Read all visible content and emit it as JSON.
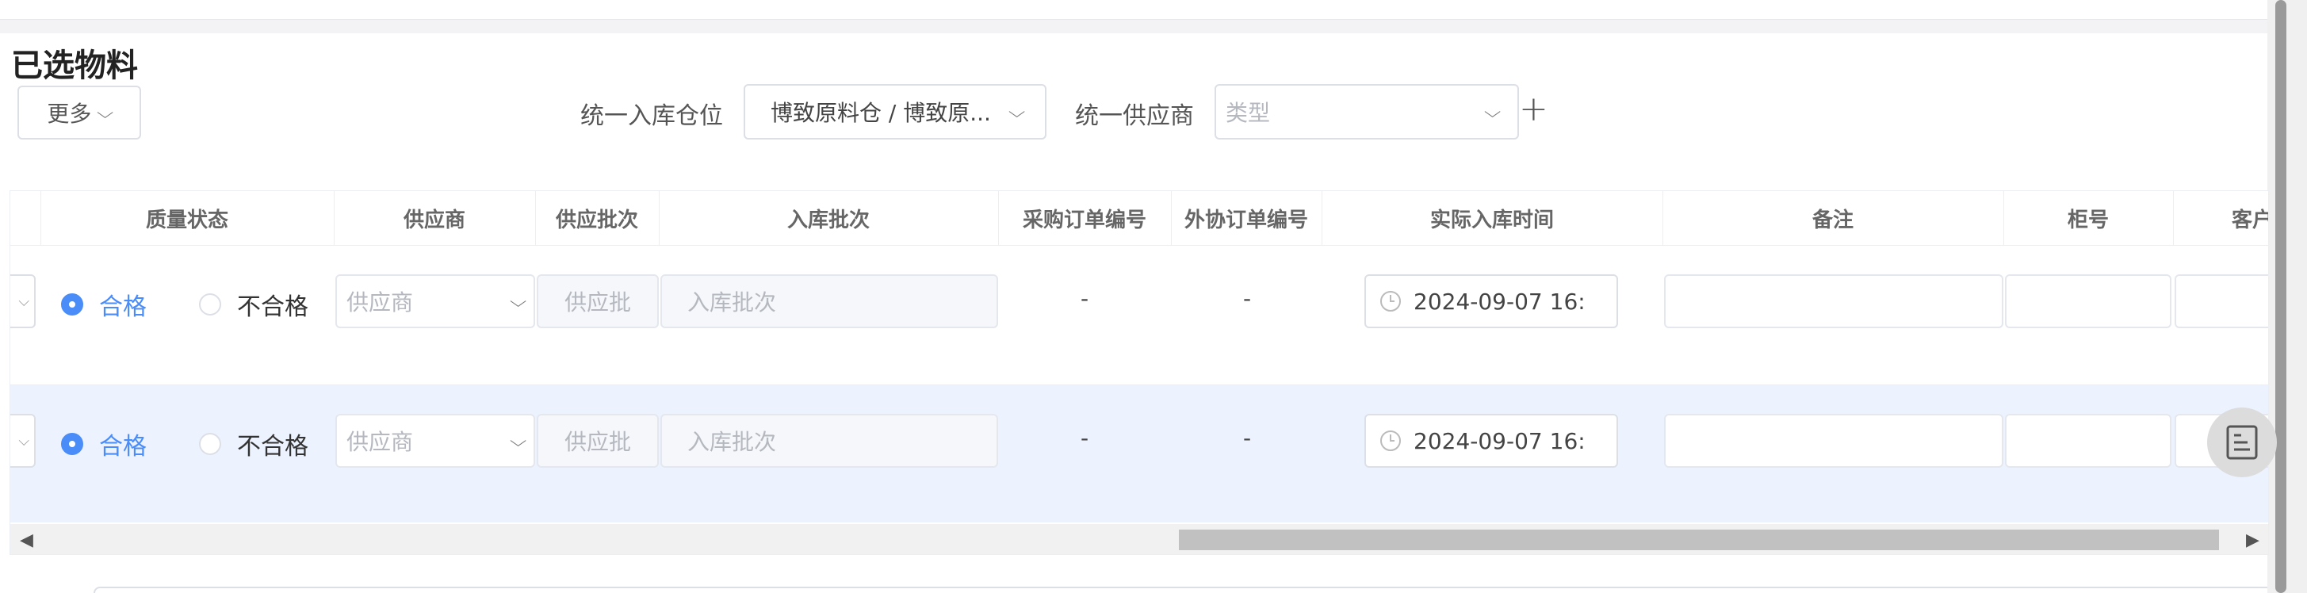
{
  "section": {
    "title": "已选物料"
  },
  "toolbar": {
    "more_label": "更多",
    "warehouse_label": "统一入库仓位",
    "warehouse_value": "博致原料仓 / 博致原...",
    "supplier_label": "统一供应商",
    "supplier_placeholder": "类型",
    "add_symbol": "+"
  },
  "table": {
    "headers": {
      "quality": "质量状态",
      "supplier": "供应商",
      "supply_batch": "供应批次",
      "inbound_batch": "入库批次",
      "po_number": "采购订单编号",
      "outsource_number": "外协订单编号",
      "actual_time": "实际入库时间",
      "remark": "备注",
      "cabinet": "柜号",
      "customer": "客户"
    },
    "rows": [
      {
        "quality_pass": "合格",
        "quality_fail": "不合格",
        "quality_selected": "合格",
        "supplier_placeholder": "供应商",
        "supply_batch_placeholder": "供应批",
        "inbound_batch_placeholder": "入库批次",
        "po_number": "-",
        "outsource_number": "-",
        "actual_time": "2024-09-07 16:",
        "remark": "",
        "cabinet": ""
      },
      {
        "quality_pass": "合格",
        "quality_fail": "不合格",
        "quality_selected": "合格",
        "supplier_placeholder": "供应商",
        "supply_batch_placeholder": "供应批",
        "inbound_batch_placeholder": "入库批次",
        "po_number": "-",
        "outsource_number": "-",
        "actual_time": "2024-09-07 16:",
        "remark": "",
        "cabinet": ""
      }
    ]
  },
  "colors": {
    "accent": "#4b8df8",
    "row_hover": "#ecf3fe",
    "border": "#dcdfe6"
  },
  "icons": {
    "float_button": "document-list-icon"
  }
}
